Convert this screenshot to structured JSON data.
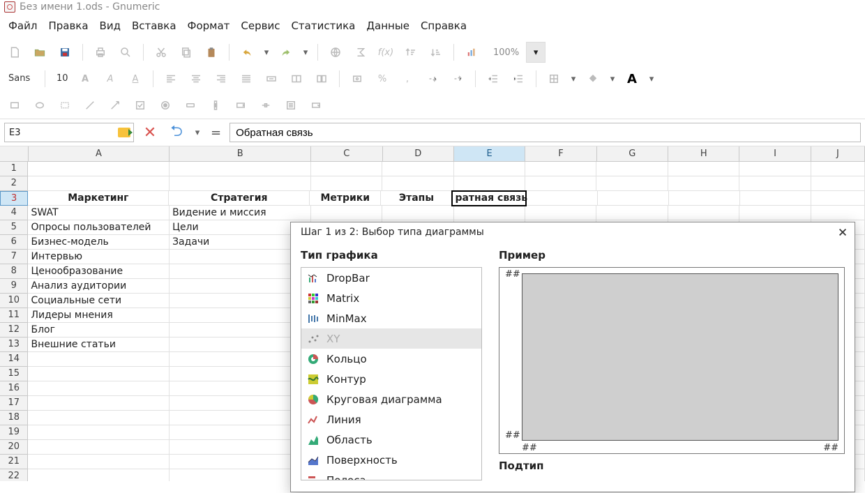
{
  "window": {
    "title": "Без имени 1.ods - Gnumeric"
  },
  "menu": [
    "Файл",
    "Правка",
    "Вид",
    "Вставка",
    "Формат",
    "Сервис",
    "Статистика",
    "Данные",
    "Справка"
  ],
  "toolbar1": {
    "font_name": "Sans",
    "font_size": "10",
    "zoom": "100%"
  },
  "formula_bar": {
    "cell_ref": "E3",
    "eq": "=",
    "value": "Обратная связь"
  },
  "columns": [
    "A",
    "B",
    "C",
    "D",
    "E",
    "F",
    "G",
    "H",
    "I",
    "J"
  ],
  "col_widths": {
    "A": 210,
    "B": 210,
    "C": 106,
    "D": 106,
    "E": 106,
    "F": 106,
    "G": 106,
    "H": 106,
    "I": 106,
    "J": 80
  },
  "active_col": "E",
  "row_count": 22,
  "active_row": 3,
  "headers_row": 3,
  "headers": {
    "A": "Маркетинг",
    "B": "Стратегия",
    "C": "Метрики",
    "D": "Этапы",
    "E": "Обратная связь"
  },
  "active_cell_clipped_text": "ратная связь",
  "cells": {
    "r4": {
      "A": "SWAT",
      "B": "Видение и миссия"
    },
    "r5": {
      "A": "Опросы пользователей",
      "B": "Цели"
    },
    "r6": {
      "A": "Бизнес-модель",
      "B": "Задачи"
    },
    "r7": {
      "A": "Интервью"
    },
    "r8": {
      "A": "Ценообразование"
    },
    "r9": {
      "A": "Анализ аудитории"
    },
    "r10": {
      "A": "Социальные сети"
    },
    "r11": {
      "A": "Лидеры мнения"
    },
    "r12": {
      "A": "Блог"
    },
    "r13": {
      "A": "Внешние статьи"
    }
  },
  "dialog": {
    "title": "Шаг 1 из 2: Выбор типа диаграммы",
    "type_label": "Тип графика",
    "preview_label": "Пример",
    "subtype_label": "Подтип",
    "hash": "##",
    "types": [
      "DropBar",
      "Matrix",
      "MinMax",
      "XY",
      "Кольцо",
      "Контур",
      "Круговая диаграмма",
      "Линия",
      "Область",
      "Поверхность",
      "Полоса"
    ],
    "selected_type_index": 3
  }
}
